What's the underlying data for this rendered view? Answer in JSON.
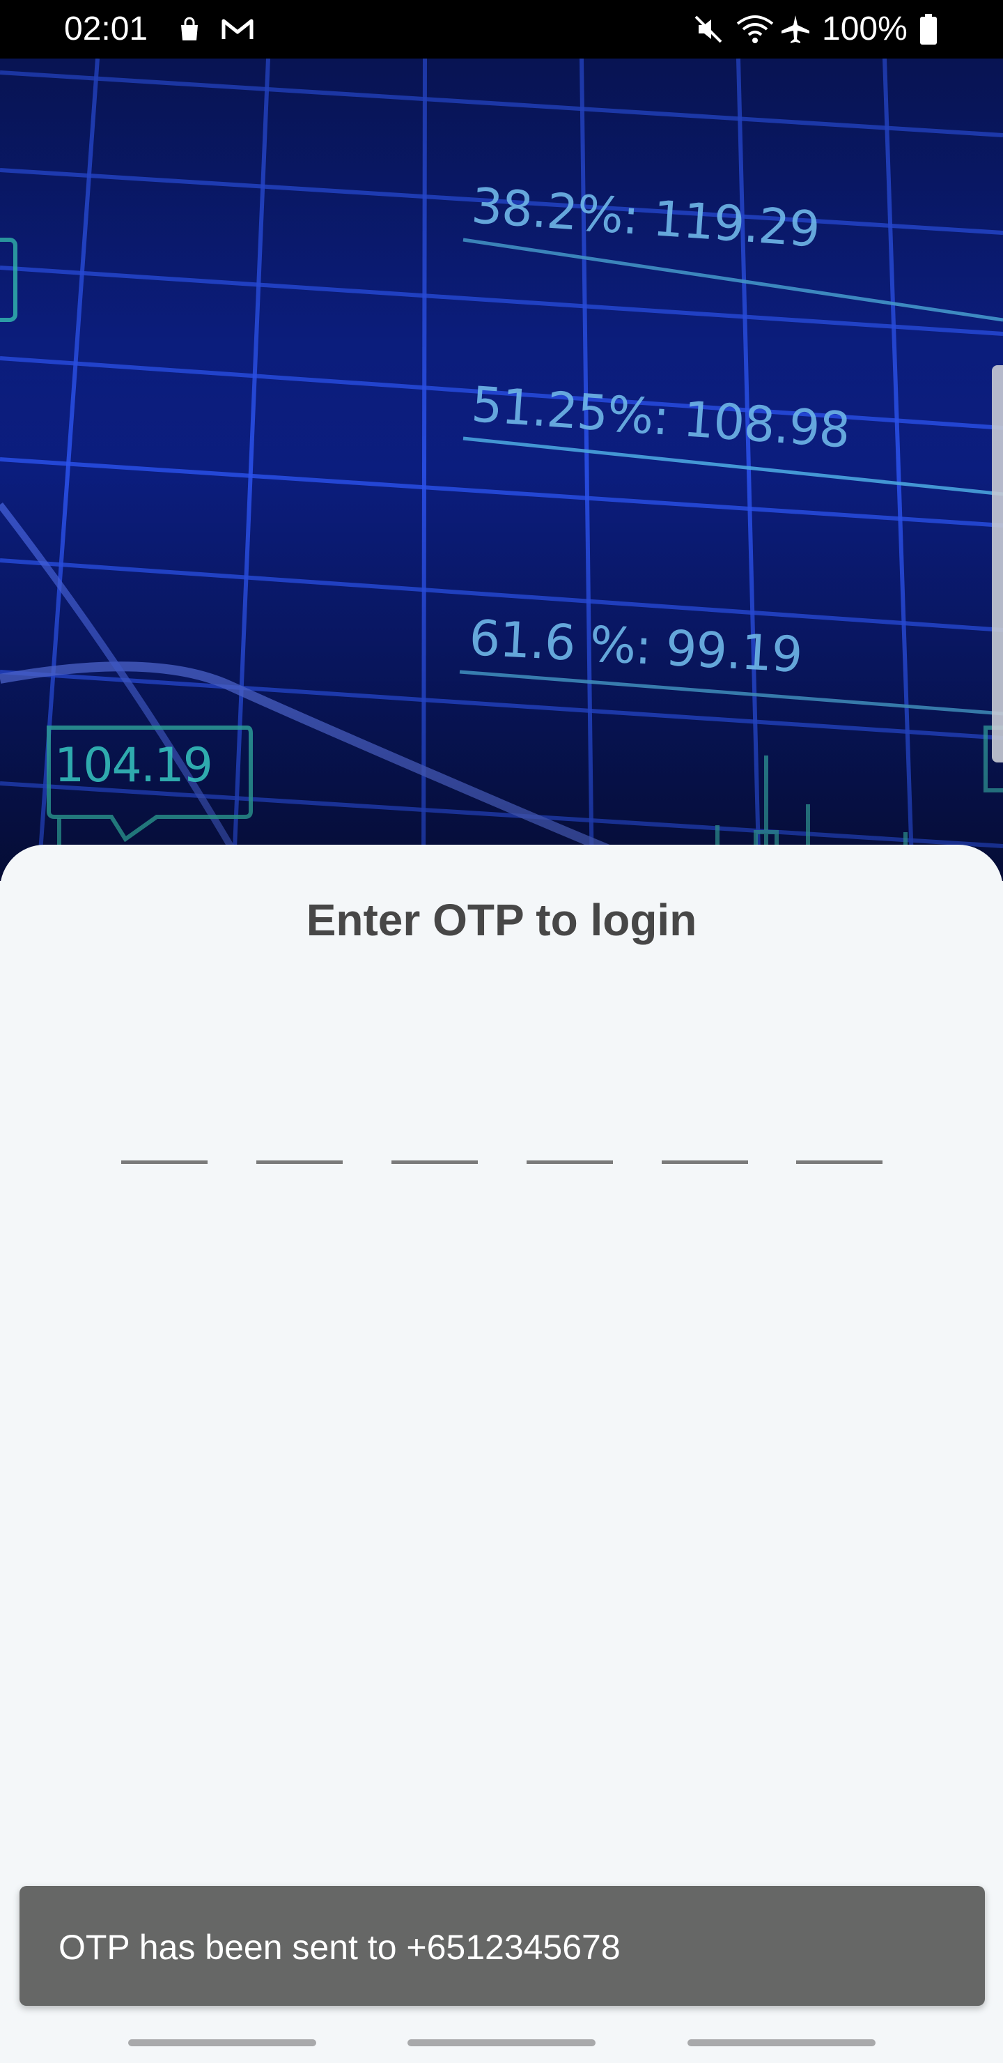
{
  "status_bar": {
    "time": "02:01",
    "battery_percent": "100%",
    "icons": [
      "shopping-bag-icon",
      "gmail-icon",
      "mute-icon",
      "wifi-icon",
      "airplane-mode-icon",
      "battery-icon"
    ]
  },
  "hero": {
    "fib_levels": [
      "38.2%: 119.29",
      "51.25%: 108.98",
      "61.6 %:  99.19"
    ],
    "price_tag": "104.19",
    "colors": {
      "background": "#0c1f86",
      "grid": "#2a4de0",
      "label": "#6fb7e8",
      "accent": "#37c6c0"
    }
  },
  "login": {
    "title": "Enter OTP to login",
    "otp_digits": [
      "",
      "",
      "",
      "",
      "",
      ""
    ]
  },
  "snackbar": {
    "message": "OTP has been sent to +6512345678"
  },
  "colors": {
    "sheet_background": "#f4f7f9",
    "title_text": "#474747",
    "snackbar_background": "#666766"
  }
}
